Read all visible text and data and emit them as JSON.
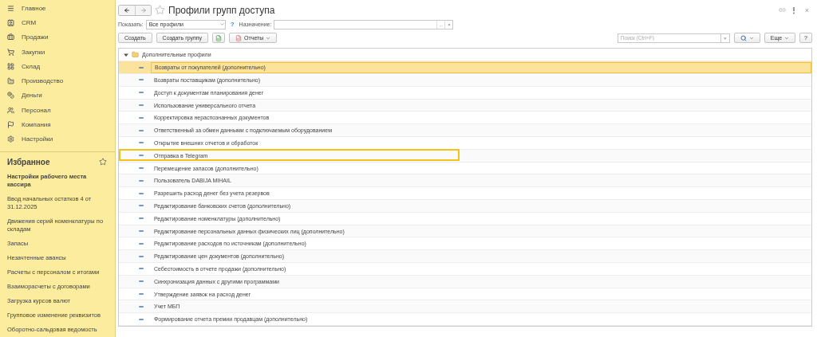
{
  "sidebar": {
    "sections": [
      {
        "label": "Главное"
      },
      {
        "label": "CRM"
      },
      {
        "label": "Продажи"
      },
      {
        "label": "Закупки"
      },
      {
        "label": "Склад"
      },
      {
        "label": "Производство"
      },
      {
        "label": "Деньги"
      },
      {
        "label": "Персонал"
      },
      {
        "label": "Компания"
      },
      {
        "label": "Настройки"
      }
    ],
    "favorites": {
      "title": "Избранное",
      "items": [
        {
          "label": "Настройки рабочего места кассира",
          "current": true
        },
        {
          "label": "Ввод начальных остатков 4 от 31.12.2025",
          "current": false
        },
        {
          "label": "Движения серий номенклатуры по складам",
          "current": false
        },
        {
          "label": "Запасы",
          "current": false
        },
        {
          "label": "Незачтенные авансы",
          "current": false
        },
        {
          "label": "Расчеты с персоналом с итогами",
          "current": false
        },
        {
          "label": "Взаиморасчеты с договорами",
          "current": false
        },
        {
          "label": "Загрузка курсов валют",
          "current": false
        },
        {
          "label": "Групповое изменение реквизитов",
          "current": false
        },
        {
          "label": "Оборотно-сальдовая ведомость",
          "current": false
        }
      ]
    }
  },
  "window": {
    "title": "Профили групп доступа",
    "close": "×"
  },
  "filter": {
    "show_label": "Показать:",
    "show_value": "Все профили",
    "help": "?",
    "purpose_label": "Назначение:",
    "choose": "...",
    "clear": "×"
  },
  "toolbar": {
    "create": "Создать",
    "create_group": "Создать группу",
    "reports": "Отчеты",
    "search_placeholder": "Поиск (Ctrl+F)",
    "search_clear": "×",
    "more": "Еще",
    "help": "?"
  },
  "tree": {
    "label": "Дополнительные профили",
    "expanded": true,
    "children": [
      {
        "label": "Возвраты от покупателей (дополнительно)",
        "selected": true,
        "highlighted": false
      },
      {
        "label": "Возвраты поставщикам (дополнительно)",
        "selected": false,
        "highlighted": false
      },
      {
        "label": "Доступ к документам планирования денег",
        "selected": false,
        "highlighted": false
      },
      {
        "label": "Использование универсального отчета",
        "selected": false,
        "highlighted": false
      },
      {
        "label": "Корректировка нераспознанных документов",
        "selected": false,
        "highlighted": false
      },
      {
        "label": "Ответственный за обмен данными с подключаемым оборудованием",
        "selected": false,
        "highlighted": false
      },
      {
        "label": "Открытие внешних отчетов и обработок",
        "selected": false,
        "highlighted": false
      },
      {
        "label": "Отправка в Telegram",
        "selected": false,
        "highlighted": true
      },
      {
        "label": "Перемещение запасов (дополнительно)",
        "selected": false,
        "highlighted": false
      },
      {
        "label": "Пользователь DABIJA MIHAIL",
        "selected": false,
        "highlighted": false
      },
      {
        "label": "Разрешить расход денег без учета резервов",
        "selected": false,
        "highlighted": false
      },
      {
        "label": "Редактирование банковских счетов (дополнительно)",
        "selected": false,
        "highlighted": false
      },
      {
        "label": "Редактирование номенклатуры (дополнительно)",
        "selected": false,
        "highlighted": false
      },
      {
        "label": "Редактирование персональных данных физических лиц (дополнительно)",
        "selected": false,
        "highlighted": false
      },
      {
        "label": "Редактирование расходов по источникам (дополнительно)",
        "selected": false,
        "highlighted": false
      },
      {
        "label": "Редактирование цен документов (дополнительно)",
        "selected": false,
        "highlighted": false
      },
      {
        "label": "Себестоимость в отчете продажи (дополнительно)",
        "selected": false,
        "highlighted": false
      },
      {
        "label": "Синхронизация данных с другими программами",
        "selected": false,
        "highlighted": false
      },
      {
        "label": "Утверждение заявок на расход денег",
        "selected": false,
        "highlighted": false
      },
      {
        "label": "Учет МБП",
        "selected": false,
        "highlighted": false
      },
      {
        "label": "Формирование отчета премии продавцам (дополнительно)",
        "selected": false,
        "highlighted": false
      }
    ]
  }
}
